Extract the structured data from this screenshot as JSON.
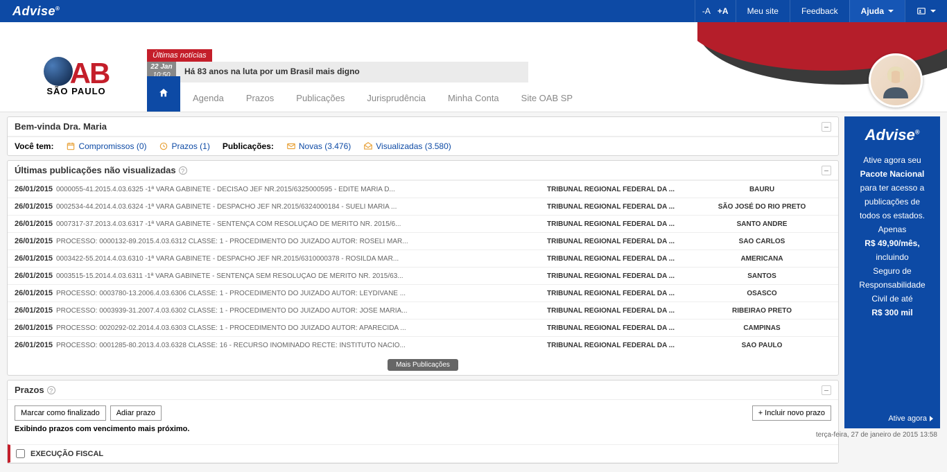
{
  "topbar": {
    "brand": "Advise",
    "fontDec": "-A",
    "fontInc": "+A",
    "meusite": "Meu site",
    "feedback": "Feedback",
    "ajuda": "Ajuda"
  },
  "news": {
    "badge": "Últimas notícias",
    "date_day": "22 Jan",
    "date_time": "10:50",
    "headline": "Há 83 anos na luta por um Brasil mais digno"
  },
  "logo": {
    "sub": "SÃO PAULO"
  },
  "nav": {
    "agenda": "Agenda",
    "prazos": "Prazos",
    "publicacoes": "Publicações",
    "juris": "Jurisprudência",
    "minhaconta": "Minha Conta",
    "siteoab": "Site OAB SP"
  },
  "welcome": {
    "title": "Bem-vinda Dra. Maria",
    "voce_tem": "Você tem:",
    "compromissos": "Compromissos (0)",
    "prazos": "Prazos (1)",
    "publicacoes_label": "Publicações:",
    "novas": "Novas (3.476)",
    "visualizadas": "Visualizadas (3.580)"
  },
  "pubpanel": {
    "title": "Últimas publicações não visualizadas",
    "more": "Mais Publicações",
    "rows": [
      {
        "date": "26/01/2015",
        "desc": "0000055-41.2015.4.03.6325 -1ª VARA GABINETE - DECISÃO JEF Nr.2015/6325000595 - EDITE MARIA D...",
        "trib": "TRIBUNAL REGIONAL FEDERAL DA ...",
        "city": "BAURU"
      },
      {
        "date": "26/01/2015",
        "desc": "0002534-44.2014.4.03.6324 -1ª VARA GABINETE - DESPACHO JEF Nr.2015/6324000184 - SUELI MARIA ...",
        "trib": "TRIBUNAL REGIONAL FEDERAL DA ...",
        "city": "SÃO JOSÉ DO RIO PRETO"
      },
      {
        "date": "26/01/2015",
        "desc": "0007317-37.2013.4.03.6317 -1ª VARA GABINETE - SENTENÇA COM RESOLUÇÃO DE MÉRITO Nr. 2015/6...",
        "trib": "TRIBUNAL REGIONAL FEDERAL DA ...",
        "city": "SANTO ANDRE"
      },
      {
        "date": "26/01/2015",
        "desc": "PROCESSO: 0000132-89.2015.4.03.6312 CLASSE: 1 - PROCEDIMENTO DO JUIZADO AUTOR: ROSELI MAR...",
        "trib": "TRIBUNAL REGIONAL FEDERAL DA ...",
        "city": "SAO CARLOS"
      },
      {
        "date": "26/01/2015",
        "desc": "0003422-55.2014.4.03.6310 -1ª VARA GABINETE - DESPACHO JEF Nr.2015/6310000378 - ROSILDA MAR...",
        "trib": "TRIBUNAL REGIONAL FEDERAL DA ...",
        "city": "AMERICANA"
      },
      {
        "date": "26/01/2015",
        "desc": "0003515-15.2014.4.03.6311 -1ª VARA GABINETE - SENTENÇA SEM RESOLUÇÃO DE MÉRITO Nr. 2015/63...",
        "trib": "TRIBUNAL REGIONAL FEDERAL DA ...",
        "city": "SANTOS"
      },
      {
        "date": "26/01/2015",
        "desc": "PROCESSO: 0003780-13.2006.4.03.6306 CLASSE: 1 - PROCEDIMENTO DO JUIZADO AUTOR: LEYDIVANE ...",
        "trib": "TRIBUNAL REGIONAL FEDERAL DA ...",
        "city": "OSASCO"
      },
      {
        "date": "26/01/2015",
        "desc": "PROCESSO: 0003939-31.2007.4.03.6302 CLASSE: 1 - PROCEDIMENTO DO JUIZADO AUTOR: JOSE MARIA...",
        "trib": "TRIBUNAL REGIONAL FEDERAL DA ...",
        "city": "RIBEIRAO PRETO"
      },
      {
        "date": "26/01/2015",
        "desc": "PROCESSO: 0020292-02.2014.4.03.6303 CLASSE: 1 - PROCEDIMENTO DO JUIZADO AUTOR: APARECIDA ...",
        "trib": "TRIBUNAL REGIONAL FEDERAL DA ...",
        "city": "CAMPINAS"
      },
      {
        "date": "26/01/2015",
        "desc": "PROCESSO: 0001285-80.2013.4.03.6328 CLASSE: 16 - RECURSO INOMINADO RECTE: INSTITUTO NACIO...",
        "trib": "TRIBUNAL REGIONAL FEDERAL DA ...",
        "city": "SAO PAULO"
      }
    ]
  },
  "prazos": {
    "title": "Prazos",
    "marcar": "Marcar como finalizado",
    "adiar": "Adiar prazo",
    "incluir": "+ Incluir novo prazo",
    "note": "Exibindo prazos com vencimento mais próximo.",
    "item": "EXECUÇÃO FISCAL"
  },
  "ad": {
    "brand": "Advise",
    "l1": "Ative agora seu",
    "l2": "Pacote Nacional",
    "l3": "para ter acesso a",
    "l4": "publicações de",
    "l5": "todos os estados.",
    "l6": "Apenas",
    "l7": "R$ 49,90/mês",
    "l8": "incluindo",
    "l9": "Seguro de",
    "l10": "Responsabilidade",
    "l11": "Civil de até",
    "l12": "R$ 300 mil",
    "cta": "Ative agora"
  },
  "footer": {
    "dt": "terça-feira, 27 de janeiro de 2015 13:58"
  }
}
